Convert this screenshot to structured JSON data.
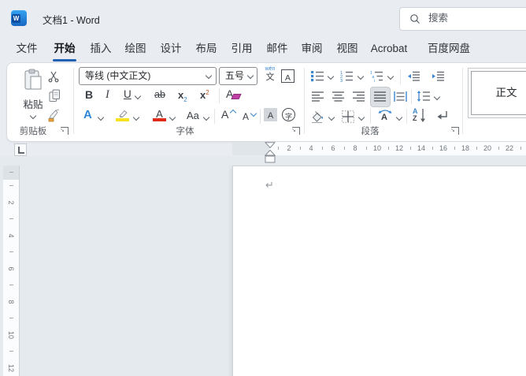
{
  "titlebar": {
    "logo_letter": "W",
    "title": "文档1  -  Word",
    "search_placeholder": "搜索"
  },
  "tabs": [
    {
      "label": "文件"
    },
    {
      "label": "开始",
      "active": true
    },
    {
      "label": "插入"
    },
    {
      "label": "绘图"
    },
    {
      "label": "设计"
    },
    {
      "label": "布局"
    },
    {
      "label": "引用"
    },
    {
      "label": "邮件"
    },
    {
      "label": "审阅"
    },
    {
      "label": "视图"
    },
    {
      "label": "Acrobat"
    },
    {
      "label": "百度网盘"
    }
  ],
  "ribbon": {
    "clipboard": {
      "paste_label": "粘贴",
      "group_label": "剪贴板"
    },
    "font": {
      "font_name": "等线 (中文正文)",
      "font_size": "五号",
      "group_label": "字体",
      "bold": "B",
      "italic": "I",
      "underline": "U",
      "strikethrough": "ab",
      "subscript_x": "x",
      "subscript_2": "2",
      "superscript_x": "x",
      "superscript_2": "2",
      "clear_format": "A",
      "text_effects": "A",
      "font_color": "A",
      "change_case": "Aa",
      "grow_font": "A",
      "shrink_font": "A",
      "char_shading": "A",
      "enclose_char": "字",
      "phonetic_ruby": "wén",
      "phonetic_char": "文",
      "char_border": "A"
    },
    "paragraph": {
      "group_label": "段落",
      "sort_a": "A",
      "sort_z": "Z",
      "asian_a": "A"
    },
    "styles": {
      "style_normal": "正文"
    }
  },
  "ruler": {
    "h": [
      "2",
      "4",
      "6",
      "8",
      "10",
      "12",
      "14",
      "16",
      "18",
      "20",
      "22"
    ],
    "v": [
      "2",
      "4",
      "6",
      "8",
      "10",
      "12"
    ]
  },
  "document": {
    "paragraph_mark": "↵"
  },
  "colors": {
    "accent_blue": "#2262b5",
    "icon_blue": "#3a87cf",
    "highlight_yellow": "#f8e11e",
    "font_color_red": "#e02b1a",
    "painter_orange": "#e9a23b",
    "eraser_magenta": "#bf3fa6"
  },
  "icons": {
    "search": "magnifier",
    "paste": "clipboard",
    "cut": "scissors",
    "copy": "two-pages",
    "format_painter": "brush",
    "bullets": "bullet-list",
    "numbering": "numbered-list",
    "multilevel": "multilevel-list",
    "decrease_indent": "lines-arrow-left",
    "increase_indent": "lines-arrow-right",
    "align": "line-stacks",
    "line_spacing": "vertical-arrows-lines",
    "shading": "paint-bucket",
    "borders": "dashed-grid",
    "sort": "a-z-arrow",
    "show_marks": "return-arrow",
    "dialog_launcher": "corner-arrow"
  }
}
